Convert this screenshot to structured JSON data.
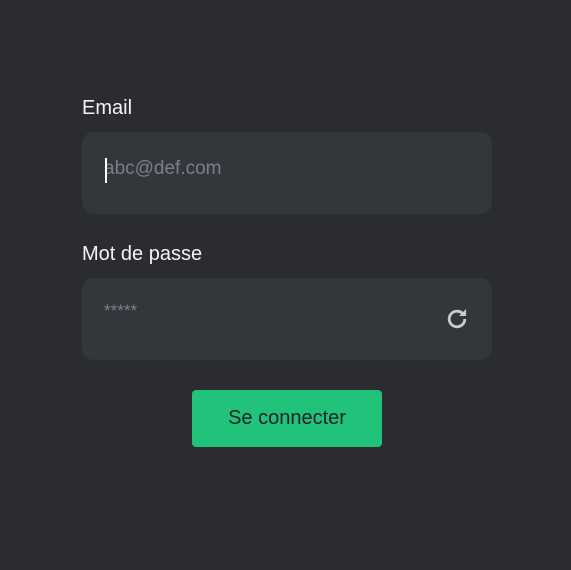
{
  "login": {
    "email": {
      "label": "Email",
      "placeholder": "abc@def.com",
      "value": ""
    },
    "password": {
      "label": "Mot de passe",
      "placeholder": "*****",
      "value": "",
      "toggle_icon": "refresh-icon"
    },
    "submit_label": "Se connecter"
  },
  "colors": {
    "background": "#2a2c2f",
    "field_background": "#33363b",
    "accent": "#21c27a",
    "label_text": "#f2f3f5",
    "placeholder_text": "#7a8089"
  }
}
